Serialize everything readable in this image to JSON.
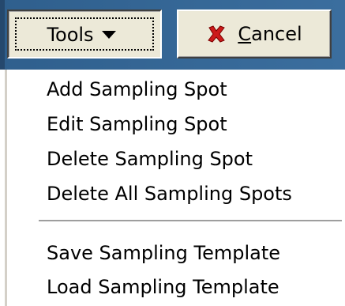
{
  "toolbar": {
    "tools_button": {
      "label": "Tools",
      "icon": "triangle-down-icon"
    },
    "cancel_button": {
      "icon": "red-x-icon",
      "accel_letter": "C",
      "label_rest": "ancel"
    }
  },
  "tools_menu": {
    "items": [
      {
        "label": "Add Sampling Spot"
      },
      {
        "label": "Edit Sampling Spot"
      },
      {
        "label": "Delete Sampling Spot"
      },
      {
        "label": "Delete All Sampling Spots"
      },
      {
        "label": "Save Sampling Template"
      },
      {
        "label": "Load Sampling Template"
      }
    ]
  },
  "colors": {
    "toolbar_bg": "#2f5f8d",
    "button_face": "#ece9d8",
    "cancel_icon": "#cc1a1a",
    "menu_bg": "#ffffff"
  }
}
